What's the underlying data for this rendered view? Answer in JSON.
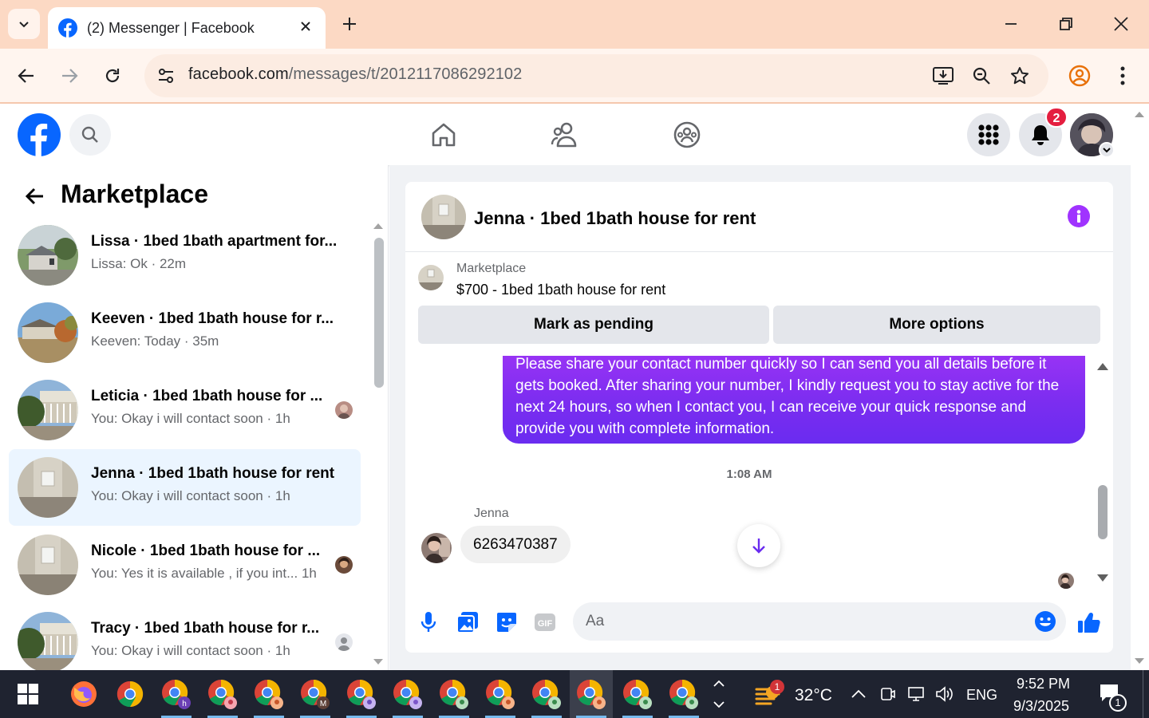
{
  "browser": {
    "tab_title": "(2) Messenger | Facebook",
    "url_host": "facebook.com",
    "url_path": "/messages/t/2012117086292102"
  },
  "facebook": {
    "notification_count": "2"
  },
  "left_panel": {
    "title": "Marketplace",
    "conversations": [
      {
        "name": "Lissa · 1bed 1bath apartment for...",
        "preview": "Lissa: Ok · 22m"
      },
      {
        "name": "Keeven · 1bed 1bath house for r...",
        "preview": "Keeven: Today · 35m"
      },
      {
        "name": "Leticia · 1bed 1bath house for ...",
        "preview": "You: Okay i will contact soon · 1h"
      },
      {
        "name": "Jenna · 1bed 1bath house for rent",
        "preview": "You: Okay i will contact soon · 1h"
      },
      {
        "name": "Nicole · 1bed 1bath house for ...",
        "preview": "You: Yes it is available , if you int...  1h"
      },
      {
        "name": "Tracy · 1bed 1bath house for r...",
        "preview": "You: Okay i will contact soon · 1h"
      }
    ]
  },
  "chat": {
    "title": "Jenna · 1bed 1bath house for rent",
    "marketplace_label": "Marketplace",
    "listing": "$700 - 1bed 1bath house for rent",
    "mark_pending": "Mark as pending",
    "more_options": "More options",
    "outgoing_message": "Please share your contact number quickly so I can send you all details before it gets booked. After sharing your number, I kindly request you to stay active for the next 24 hours, so when I contact you, I can receive your quick response and provide you with complete information.",
    "timestamp": "1:08 AM",
    "sender_name": "Jenna",
    "incoming_message": "6263470387",
    "composer_placeholder": "Aa"
  },
  "taskbar": {
    "weather_badge": "1",
    "temperature": "32°C",
    "language": "ENG",
    "time": "9:52 PM",
    "date": "9/3/2025",
    "notification_count": "1"
  },
  "colors": {
    "facebook_blue": "#0866ff",
    "messenger_purple": "#a033ff",
    "active_conversation": "#ebf5ff",
    "tab_strip": "#fcd9c4"
  }
}
